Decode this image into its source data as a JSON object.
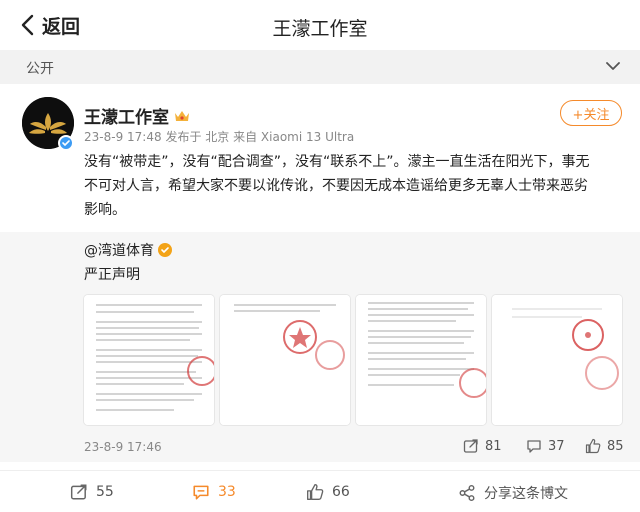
{
  "header": {
    "back_label": "返回",
    "title": "王濛工作室"
  },
  "visibility": {
    "label": "公开"
  },
  "post": {
    "author": "王濛工作室",
    "time": "23-8-9 17:48",
    "location": "发布于 北京",
    "device": "来自 Xiaomi 13 Ultra",
    "follow_label": "+关注",
    "text_lines": [
      "没有“被带走”，没有“配合调查”，没有“联系不上”。濛主一直生活在阳光下，事无",
      "不可对人言，希望大家不要以讹传讹，不要因无成本造谣给更多无辜人士带来恶劣",
      "影响。"
    ]
  },
  "repost": {
    "author": "@湾道体育",
    "text": "严正声明",
    "time": "23-8-9 17:46",
    "reposts": "81",
    "comments": "37",
    "likes": "85",
    "images": [
      "statement-page-1",
      "statement-page-2",
      "statement-page-3",
      "statement-page-4"
    ]
  },
  "actions": {
    "repost_count": "55",
    "comment_count": "33",
    "like_count": "66",
    "share_label": "分享这条博文"
  },
  "colors": {
    "accent": "#f58a2b",
    "verified_blue": "#3d9cf4",
    "repost_bg": "#f6f6f6",
    "stamp_red": "#d23b3b"
  },
  "icons": [
    "back-chevron-icon",
    "chevron-down-icon",
    "crown-icon",
    "verified-icon",
    "repost-icon",
    "comment-icon",
    "like-icon",
    "share-icon"
  ]
}
